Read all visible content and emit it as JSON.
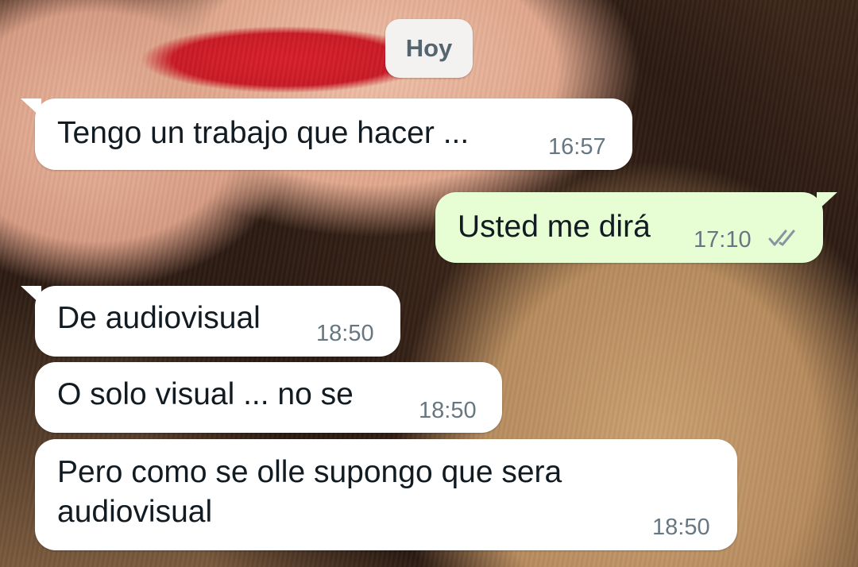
{
  "date_chip": {
    "label": "Hoy"
  },
  "messages": [
    {
      "direction": "incoming",
      "text": "Tengo un trabajo que hacer ...",
      "time": "16:57"
    },
    {
      "direction": "outgoing",
      "text": "Usted me dirá",
      "time": "17:10",
      "status_icon": "double-check-icon"
    },
    {
      "direction": "incoming",
      "text": "De audiovisual",
      "time": "18:50"
    },
    {
      "direction": "incoming",
      "text": "O solo visual ... no se",
      "time": "18:50"
    },
    {
      "direction": "incoming",
      "text": "Pero como se olle supongo que sera\naudiovisual",
      "time": "18:50"
    }
  ],
  "colors": {
    "incoming_bubble": "#ffffff",
    "outgoing_bubble": "#e7fdd4",
    "timestamp": "#667781",
    "read_ticks": "#8696a0"
  }
}
